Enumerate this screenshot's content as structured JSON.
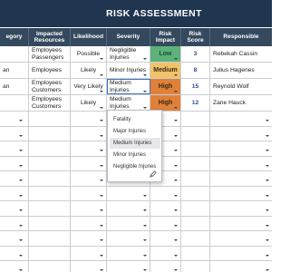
{
  "title": "RISK ASSESSMENT",
  "columns": [
    "egory",
    "Impacted Resources",
    "Likelihood",
    "Severity",
    "Risk Impact",
    "Risk Score",
    "Responsible"
  ],
  "rows": [
    {
      "category": "",
      "resources": "Employees Passengers",
      "likelihood": "Possible",
      "severity": "Negligible Injuries",
      "impact": "Low",
      "score": "3",
      "responsible": "Rebekah Cassin"
    },
    {
      "category": "an",
      "resources": "Employees",
      "likelihood": "Likely",
      "severity": "Minor Injuries",
      "impact": "Medium",
      "score": "8",
      "responsible": "Julius Hagenes"
    },
    {
      "category": "an",
      "resources": "Employees Customers",
      "likelihood": "Very Likely",
      "severity": "Medium Injuries",
      "impact": "High",
      "score": "15",
      "responsible": "Reynold Wolf"
    },
    {
      "category": "",
      "resources": "Employees Customers",
      "likelihood": "Likely",
      "severity": "Medium Injuries",
      "impact": "High",
      "score": "12",
      "responsible": "Zane Hauck"
    }
  ],
  "impact_colors": {
    "Low": "#5cb27a",
    "Medium": "#f0c36a",
    "High": "#e0813a"
  },
  "dropdown": {
    "options": [
      "Fatality",
      "Major Injuries",
      "Medium Injuries",
      "Minor Injuries",
      "Negligible Injuries"
    ],
    "selected": "Medium Injuries",
    "edit_icon": "pencil-icon"
  },
  "colors": {
    "title_bg": "#1f3550",
    "header_bg": "#34495e",
    "edit_outline": "#3b70c9"
  }
}
